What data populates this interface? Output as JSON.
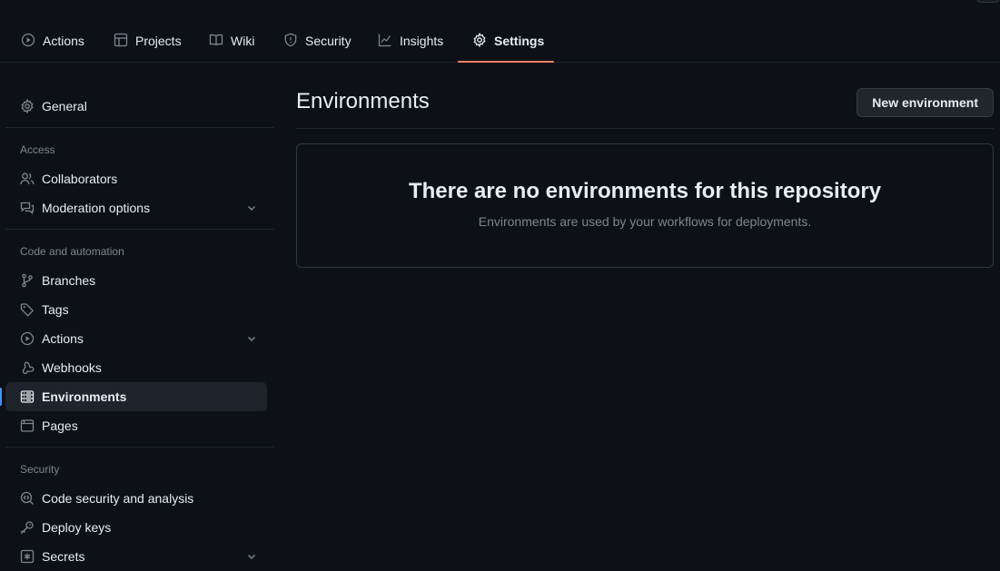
{
  "repo_tabs": [
    {
      "label": "Actions",
      "icon": "play-circle-icon"
    },
    {
      "label": "Projects",
      "icon": "table-icon"
    },
    {
      "label": "Wiki",
      "icon": "book-icon"
    },
    {
      "label": "Security",
      "icon": "shield-icon"
    },
    {
      "label": "Insights",
      "icon": "graph-icon"
    },
    {
      "label": "Settings",
      "icon": "gear-icon",
      "active": true
    }
  ],
  "sidebar": {
    "general": "General",
    "access_heading": "Access",
    "collaborators": "Collaborators",
    "moderation": "Moderation options",
    "code_heading": "Code and automation",
    "branches": "Branches",
    "tags": "Tags",
    "actions": "Actions",
    "webhooks": "Webhooks",
    "environments": "Environments",
    "pages": "Pages",
    "security_heading": "Security",
    "code_security": "Code security and analysis",
    "deploy_keys": "Deploy keys",
    "secrets": "Secrets"
  },
  "main": {
    "title": "Environments",
    "new_button": "New environment",
    "empty_title": "There are no environments for this repository",
    "empty_desc": "Environments are used by your workflows for deployments."
  },
  "colors": {
    "background": "#0d1117",
    "active_tab_underline": "#f78166",
    "selected_indicator": "#4493f8",
    "muted_text": "#7d8590"
  }
}
